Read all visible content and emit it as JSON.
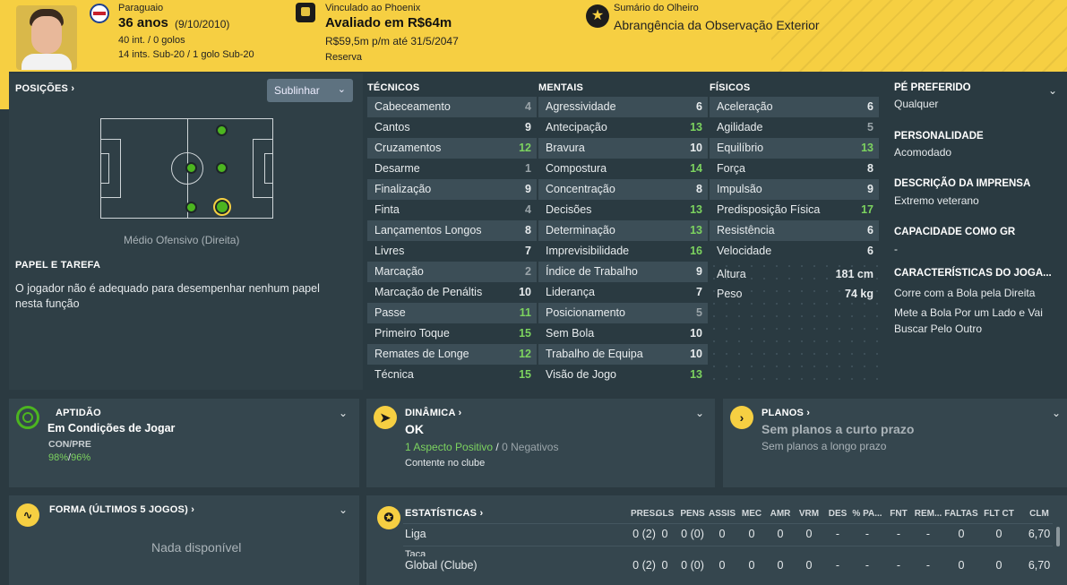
{
  "header": {
    "nationality": "Paraguaio",
    "age": "36 anos",
    "birth": "(9/10/2010)",
    "caps": "40 int. / 0 golos",
    "youth_caps": "14 ints. Sub-20 / 1 golo Sub-20",
    "club_link": "Vinculado ao Phoenix",
    "value": "Avaliado em R$64m",
    "wage": "R$59,5m p/m até 31/5/2047",
    "squad_status": "Reserva",
    "scout_title": "Sumário do Olheiro",
    "scout_value": "Abrangência da Observação Exterior"
  },
  "positions": {
    "title": "POSIÇÕES ›",
    "highlight_label": "Sublinhar",
    "position_label": "Médio Ofensivo (Direita)",
    "role_title": "PAPEL E TAREFA",
    "role_text_1": "O jogador não é adequado para desempenhar nenhum papel",
    "role_text_2": "nesta função"
  },
  "technical": {
    "title": "TÉCNICOS",
    "rows": [
      {
        "name": "Cabeceamento",
        "value": "4",
        "tone": "dim"
      },
      {
        "name": "Cantos",
        "value": "9",
        "tone": "normal"
      },
      {
        "name": "Cruzamentos",
        "value": "12",
        "tone": "green"
      },
      {
        "name": "Desarme",
        "value": "1",
        "tone": "dim"
      },
      {
        "name": "Finalização",
        "value": "9",
        "tone": "normal"
      },
      {
        "name": "Finta",
        "value": "4",
        "tone": "dim"
      },
      {
        "name": "Lançamentos Longos",
        "value": "8",
        "tone": "normal"
      },
      {
        "name": "Livres",
        "value": "7",
        "tone": "normal"
      },
      {
        "name": "Marcação",
        "value": "2",
        "tone": "dim"
      },
      {
        "name": "Marcação de Penáltis",
        "value": "10",
        "tone": "normal"
      },
      {
        "name": "Passe",
        "value": "11",
        "tone": "green"
      },
      {
        "name": "Primeiro Toque",
        "value": "15",
        "tone": "green"
      },
      {
        "name": "Remates de Longe",
        "value": "12",
        "tone": "green"
      },
      {
        "name": "Técnica",
        "value": "15",
        "tone": "green"
      }
    ]
  },
  "mental": {
    "title": "MENTAIS",
    "rows": [
      {
        "name": "Agressividade",
        "value": "6",
        "tone": "normal"
      },
      {
        "name": "Antecipação",
        "value": "13",
        "tone": "green"
      },
      {
        "name": "Bravura",
        "value": "10",
        "tone": "normal"
      },
      {
        "name": "Compostura",
        "value": "14",
        "tone": "green"
      },
      {
        "name": "Concentração",
        "value": "8",
        "tone": "normal"
      },
      {
        "name": "Decisões",
        "value": "13",
        "tone": "green"
      },
      {
        "name": "Determinação",
        "value": "13",
        "tone": "green"
      },
      {
        "name": "Imprevisibilidade",
        "value": "16",
        "tone": "green"
      },
      {
        "name": "Índice de Trabalho",
        "value": "9",
        "tone": "normal"
      },
      {
        "name": "Liderança",
        "value": "7",
        "tone": "normal"
      },
      {
        "name": "Posicionamento",
        "value": "5",
        "tone": "dim"
      },
      {
        "name": "Sem Bola",
        "value": "10",
        "tone": "normal"
      },
      {
        "name": "Trabalho de Equipa",
        "value": "10",
        "tone": "normal"
      },
      {
        "name": "Visão de Jogo",
        "value": "13",
        "tone": "green"
      }
    ]
  },
  "physical": {
    "title": "FÍSICOS",
    "rows": [
      {
        "name": "Aceleração",
        "value": "6",
        "tone": "normal"
      },
      {
        "name": "Agilidade",
        "value": "5",
        "tone": "dim"
      },
      {
        "name": "Equilíbrio",
        "value": "13",
        "tone": "green"
      },
      {
        "name": "Força",
        "value": "8",
        "tone": "normal"
      },
      {
        "name": "Impulsão",
        "value": "9",
        "tone": "normal"
      },
      {
        "name": "Predisposição Física",
        "value": "17",
        "tone": "green"
      },
      {
        "name": "Resistência",
        "value": "6",
        "tone": "normal"
      },
      {
        "name": "Velocidade",
        "value": "6",
        "tone": "normal"
      }
    ],
    "height_label": "Altura",
    "height_value": "181 cm",
    "weight_label": "Peso",
    "weight_value": "74 kg"
  },
  "info": {
    "foot_title": "PÉ PREFERIDO",
    "foot_value": "Qualquer",
    "personality_title": "PERSONALIDADE",
    "personality_value": "Acomodado",
    "media_title": "DESCRIÇÃO DA IMPRENSA",
    "media_value": "Extremo veterano",
    "gk_title": "CAPACIDADE COMO GR",
    "gk_value": "-",
    "traits_title": "CARACTERÍSTICAS DO JOGA...",
    "trait_1": "Corre com a Bola pela Direita",
    "trait_2a": "Mete a Bola Por um Lado e Vai",
    "trait_2b": "Buscar Pelo Outro"
  },
  "fitness": {
    "title": "APTIDÃO",
    "status": "Em Condições de Jogar",
    "con_label": "CON/PRE",
    "con_value": "98%",
    "separator": "/",
    "pre_value": "96%"
  },
  "dynamics": {
    "title": "DINÂMICA ›",
    "status": "OK",
    "positives": "1 Aspecto Positivo",
    "separator": "/",
    "negatives": "0 Negativos",
    "note": "Contente no clube"
  },
  "plans": {
    "title": "PLANOS ›",
    "short": "Sem planos a curto prazo",
    "long": "Sem planos a longo prazo"
  },
  "form": {
    "title": "FORMA (ÚLTIMOS 5 JOGOS) ›",
    "empty": "Nada disponível"
  },
  "stats": {
    "title": "ESTATÍSTICAS ›",
    "columns": [
      "PRES.",
      "GLS",
      "PENS",
      "ASSIS",
      "MEC",
      "AMR",
      "VRM",
      "DES",
      "% PA...",
      "FNT",
      "REM...",
      "FALTAS",
      "FLT CT",
      "CLM"
    ],
    "rows": [
      {
        "label": "Liga",
        "cells": [
          "0 (2)",
          "0",
          "0 (0)",
          "0",
          "0",
          "0",
          "0",
          "-",
          "-",
          "-",
          "-",
          "0",
          "0",
          "6,70"
        ]
      },
      {
        "label": "Taça",
        "cells": []
      },
      {
        "label": "Global (Clube)",
        "cells": [
          "0 (2)",
          "0",
          "0 (0)",
          "0",
          "0",
          "0",
          "0",
          "-",
          "-",
          "-",
          "-",
          "0",
          "0",
          "6,70"
        ]
      }
    ]
  },
  "colors": {
    "accent": "#f6cf42",
    "good": "#7cd35f",
    "panel": "#2f3f46"
  }
}
